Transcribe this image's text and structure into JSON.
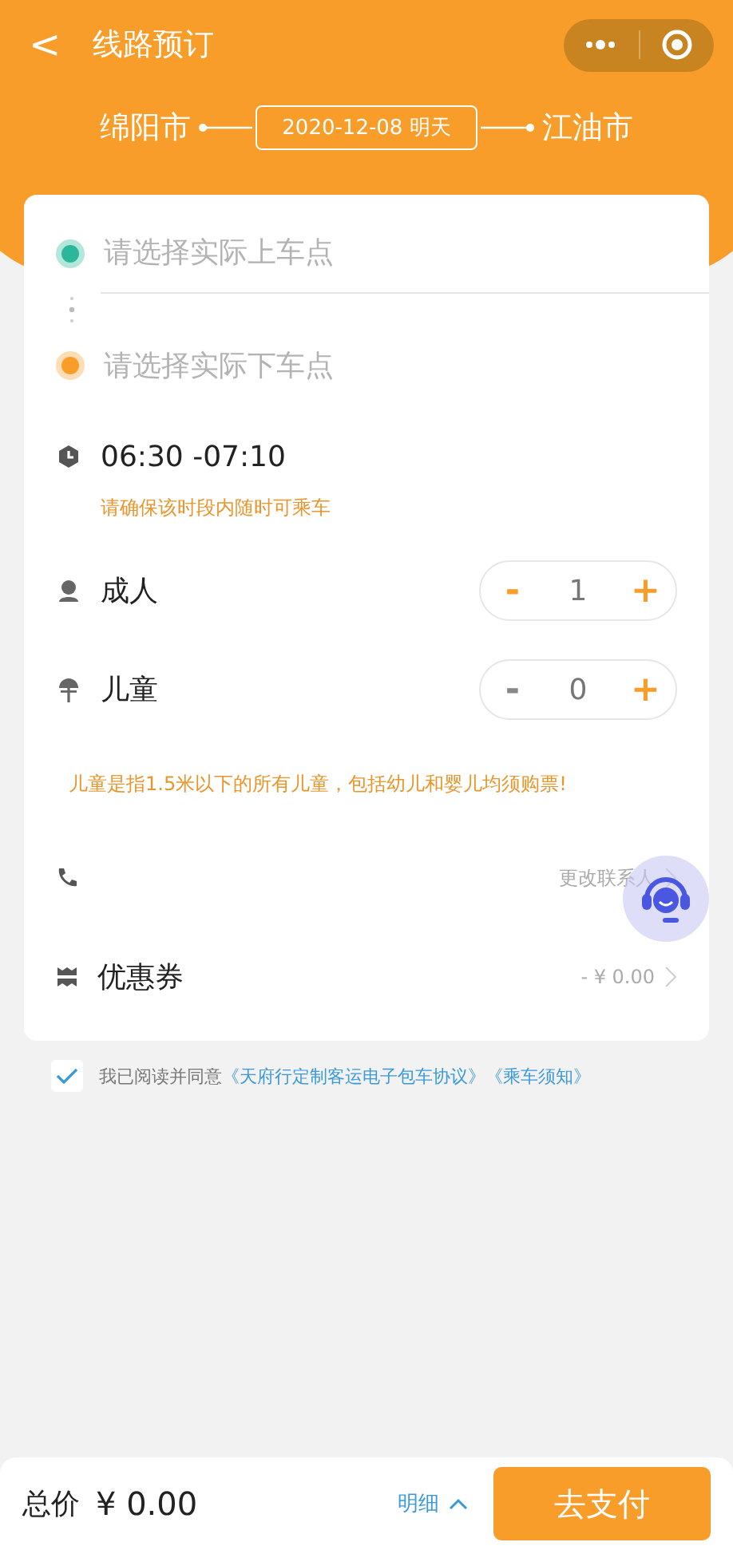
{
  "nav": {
    "back": "<",
    "title": "线路预订"
  },
  "route": {
    "from": "绵阳市",
    "date": "2020-12-08 明天",
    "to": "江油市"
  },
  "stops": [
    {
      "kind": "pickup",
      "placeholder": "请选择实际上车点"
    },
    {
      "kind": "dropoff",
      "placeholder": "请选择实际下车点"
    }
  ],
  "time": {
    "range": "06:30 -07:10",
    "note": "请确保该时段内随时可乘车"
  },
  "passengers": [
    {
      "kind": "adult",
      "label": "成人",
      "count": "1",
      "minus": "-",
      "plus": "+",
      "minus_disabled": false
    },
    {
      "kind": "child",
      "label": "儿童",
      "count": "0",
      "minus": "-",
      "plus": "+",
      "minus_disabled": true
    }
  ],
  "child_note": "儿童是指1.5米以下的所有儿童，包括幼儿和婴儿均须购票!",
  "contact": {
    "action": "更改联系人"
  },
  "coupon": {
    "label": "优惠券",
    "value": "- ¥ 0.00"
  },
  "agreement": {
    "checked": true,
    "text": "我已阅读并同意",
    "links": [
      "《天府行定制客运电子包车协议》",
      "《乘车须知》"
    ]
  },
  "footer": {
    "total_label": "总价",
    "total": "¥ 0.00",
    "detail": "明细",
    "pay": "去支付"
  }
}
